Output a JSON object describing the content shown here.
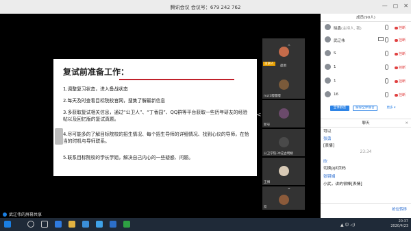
{
  "window": {
    "title": "腾讯会议  会议号：679 242 762",
    "minimize": "—",
    "maximize": "▢",
    "close": "✕"
  },
  "slide": {
    "title": "复试前准备工作：",
    "items": [
      "1.调整复习状态，进入备战状态",
      "2.每天及时查看目标院校官网，搜集了解最新信息",
      "3.多获取复试相关信息，通过“公卫人”、“丁香园”、QQ群等平台获取一些历年研友的经验帖以及回忆版的复试真题。",
      "4.尽可能多的了解目标院校的招生情况、每个招生导师的详细情况、找到心仪的导师，在恰当的时机与导师联系。",
      "5.联系目标院校的学长学姐，解决自己内心的一些疑惑、问题。"
    ]
  },
  "videos": [
    {
      "label": "晨雨",
      "tag": "主讲人",
      "face": "#c46b4a"
    },
    {
      "label": "mzi1嘤嘤嘤",
      "tag": "",
      "face": "#7a5a3a"
    },
    {
      "label": "新号",
      "tag": "",
      "face": "#6b4a6b"
    },
    {
      "label": "公卫学院-冲这古明娟",
      "tag": "",
      "face": "#4a4a4a"
    },
    {
      "label": "王博",
      "tag": "",
      "face": "#d7c9b5"
    },
    {
      "label": "欢",
      "tag": "",
      "face": "#8b5a3a"
    }
  ],
  "share_label": "武辽伟的屏幕共享",
  "panel": {
    "members_title": "成员(90人)",
    "members": [
      {
        "name": "晓鑫",
        "host": "(主持人, 我)",
        "hang": "挂断"
      },
      {
        "name": "武辽伟",
        "host": "",
        "hang": "挂断"
      },
      {
        "name": "S",
        "host": "",
        "hang": "挂断"
      },
      {
        "name": "1",
        "host": "",
        "hang": "挂断"
      },
      {
        "name": "1",
        "host": "",
        "hang": "挂断"
      },
      {
        "name": "16",
        "host": "",
        "hang": "挂断"
      }
    ],
    "buttons": {
      "mute_all": "全体静音",
      "unmute_all": "解除全体静音",
      "more": "更多 ▾"
    },
    "chat_title": "聊天",
    "chat_close": "✕",
    "chat": [
      {
        "kind": "text",
        "text": "可以"
      },
      {
        "kind": "name",
        "text": "张勇"
      },
      {
        "kind": "text",
        "text": "[表情]"
      },
      {
        "kind": "time",
        "text": "23:34"
      },
      {
        "kind": "name",
        "text": "欣"
      },
      {
        "kind": "text",
        "text": "切换ppt页码"
      },
      {
        "kind": "name",
        "text": "张钥娟"
      },
      {
        "kind": "text",
        "text": "小武，讲的很棒[表情]"
      }
    ],
    "send": "抢位转移"
  },
  "taskbar": {
    "time": "20:37",
    "date": "2020/4/23",
    "tray": "▲  中  ◁)"
  }
}
